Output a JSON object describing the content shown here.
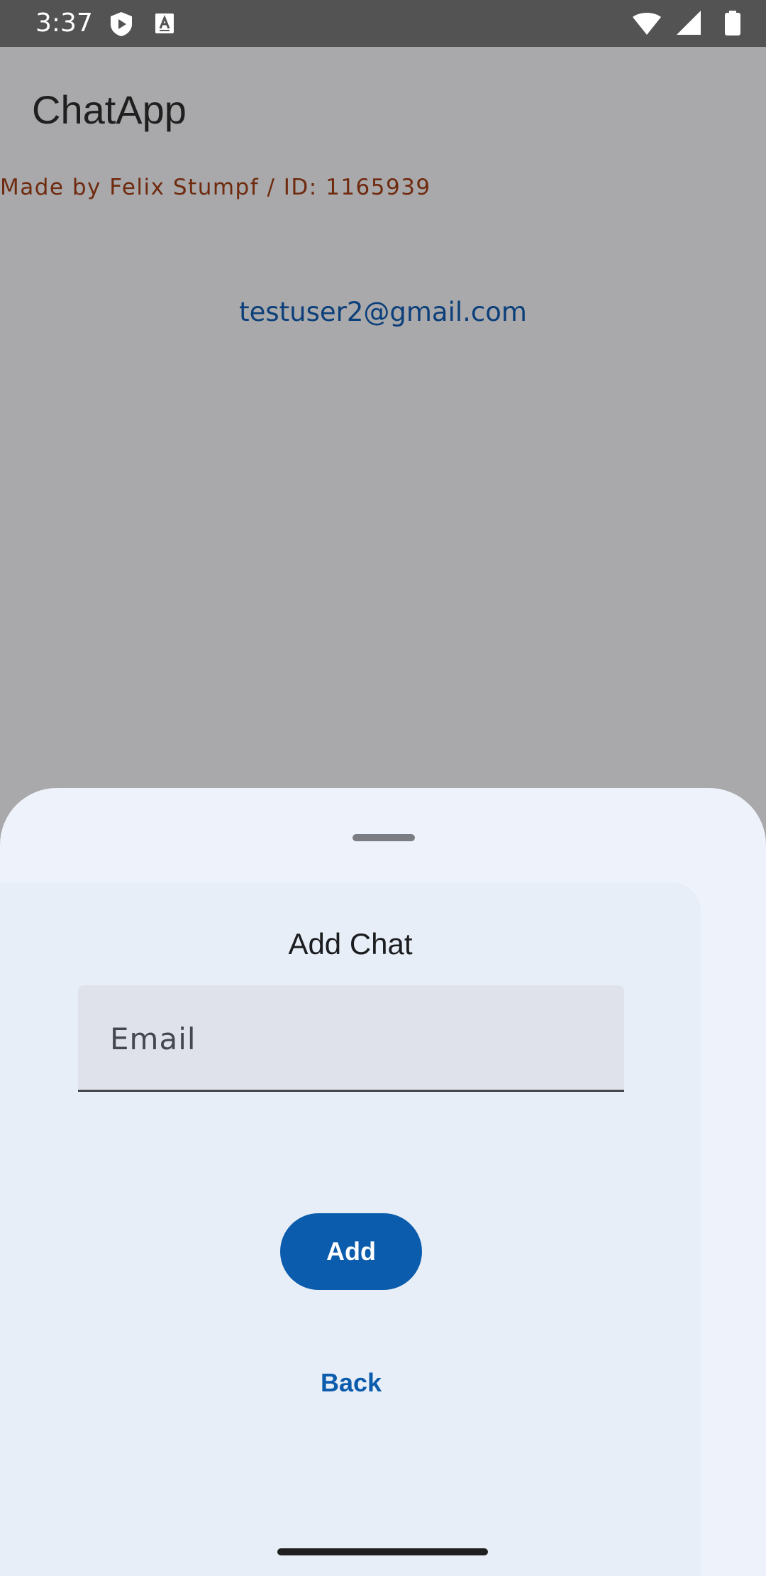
{
  "status_bar": {
    "time": "3:37",
    "left_icons": [
      "play-protect-icon",
      "keyboard-a-icon"
    ],
    "right_icons": [
      "wifi-icon",
      "signal-icon",
      "battery-icon"
    ]
  },
  "app": {
    "title": "ChatApp",
    "made_by": "Made by Felix Stumpf / ID: 1165939",
    "user_email": "testuser2@gmail.com"
  },
  "sheet": {
    "dialog": {
      "title": "Add Chat",
      "email_placeholder": "Email",
      "email_value": "",
      "add_label": "Add",
      "back_label": "Back"
    }
  },
  "colors": {
    "scrim": "#a9a9ab",
    "status_bar": "#535353",
    "primary": "#0b5cad",
    "made_by_text": "#6f2a0e",
    "email_text": "#0b3f7a",
    "sheet_bg": "#eef3fb",
    "card_bg": "#e8eef7",
    "field_bg": "#dfe2eb"
  }
}
